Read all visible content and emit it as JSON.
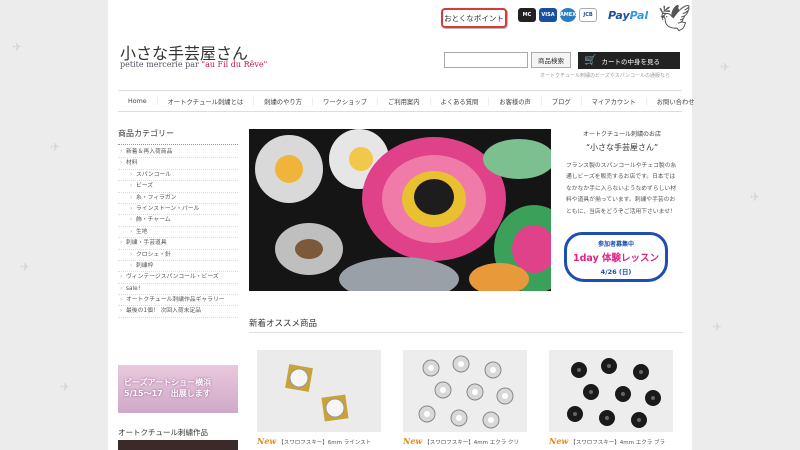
{
  "header": {
    "logo_title": "小さな手芸屋さん",
    "logo_sub_prefix": "petite mercerie par ",
    "logo_sub_brand": "\"au Fil du Rêve\"",
    "points_badge": "おとくなポイント",
    "payment_icons": [
      "mastercard-icon",
      "visa-icon",
      "amex-icon",
      "jcb-icon",
      "paypal-icon"
    ],
    "card_labels": [
      "MC",
      "VISA",
      "AMEX",
      "JCB"
    ],
    "paypal_a": "Pay",
    "paypal_b": "Pal",
    "search_button": "商品検索",
    "cart_button": "カートの中身を見る",
    "tagline": "オートクチュール刺繍のビーズやスパンコールの通販なら"
  },
  "nav": [
    "Home",
    "オートクチュール刺繍とは",
    "刺繍のやり方",
    "ワークショップ",
    "ご利用案内",
    "よくある質問",
    "お客様の声",
    "ブログ",
    "マイアカウント",
    "お問い合わせ"
  ],
  "sidebar": {
    "title": "商品カテゴリー",
    "items": [
      {
        "label": "新着＆再入荷商品",
        "sub": false
      },
      {
        "label": "材料",
        "sub": false
      },
      {
        "label": "スパンコール",
        "sub": true
      },
      {
        "label": "ビーズ",
        "sub": true
      },
      {
        "label": "糸・フィラガン",
        "sub": true
      },
      {
        "label": "ラインストーン・パール",
        "sub": true
      },
      {
        "label": "飾・チャーム",
        "sub": true
      },
      {
        "label": "生地",
        "sub": true
      },
      {
        "label": "刺繍・手芸道具",
        "sub": false
      },
      {
        "label": "クロシェ・針",
        "sub": true
      },
      {
        "label": "刺繍枠",
        "sub": true
      },
      {
        "label": "ヴィンテージスパンコール・ビーズ",
        "sub": false
      },
      {
        "label": "sale！",
        "sub": false
      },
      {
        "label": "オートクチュール刺繍作品ギャラリー",
        "sub": false
      },
      {
        "label": "最後の1個！ 次回入荷未定品",
        "sub": false
      }
    ],
    "banner_line1": "ビーズアートショー横浜",
    "banner_line2": "5/15～17　出展します",
    "gallery_title": "オートクチュール刺繍作品"
  },
  "info": {
    "subtitle": "オートクチュール刺繍のお店",
    "name": "“小さな手芸屋さん”",
    "body": "フランス製のスパンコールやチェコ製の糸通しビーズを販売するお店です。日本ではなかなか手に入らないようなめずらしい材料や道具が揃っています。刺繍や手芸のおともに、当店をどうぞご活用下さいませ！"
  },
  "lesson": {
    "line1": "参加者募集中",
    "line2": "1day 体験レッスン",
    "line3": "4/26 (日)"
  },
  "products": {
    "section_title": "新着オススメ商品",
    "new_label": "New",
    "items": [
      {
        "caption": "【スワロフスキー】6mm ラインスト"
      },
      {
        "caption": "【スワロフスキー】4mm エクラ クリ"
      },
      {
        "caption": "【スワロフスキー】4mm エクラ ブラ"
      }
    ]
  },
  "colors": {
    "accent_pink": "#e0218a",
    "accent_blue": "#1c4fb0",
    "badge_red": "#d83a3a"
  }
}
